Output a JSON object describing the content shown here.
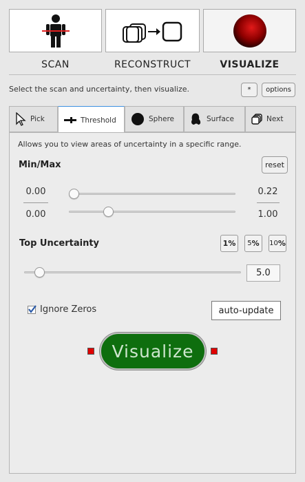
{
  "modes": [
    {
      "label": "SCAN",
      "icon": "person-scan-icon",
      "active": false
    },
    {
      "label": "RECONSTRUCT",
      "icon": "reconstruct-icon",
      "active": false
    },
    {
      "label": "VISUALIZE",
      "icon": "visualize-sphere-icon",
      "active": true
    }
  ],
  "hint": "Select the scan and uncertainty, then visualize.",
  "star_button": "*",
  "options_button": "options",
  "tabs": [
    {
      "label": "Pick",
      "icon": "cursor-icon"
    },
    {
      "label": "Threshold",
      "icon": "threshold-icon"
    },
    {
      "label": "Sphere",
      "icon": "sphere-icon"
    },
    {
      "label": "Surface",
      "icon": "surface-icon"
    },
    {
      "label": "Next",
      "icon": "next-icon"
    }
  ],
  "active_tab": "Threshold",
  "description": "Allows you to view areas of uncertainty in a specific range.",
  "minmax": {
    "title": "Min/Max",
    "reset": "reset",
    "row1": {
      "left": "0.00",
      "right": "0.22",
      "value": 0.0
    },
    "row2": {
      "left": "0.00",
      "right": "1.00",
      "value": 0.22
    }
  },
  "top_uncertainty": {
    "title": "Top Uncertainty",
    "pct_buttons": [
      {
        "num": "1",
        "sym": "%"
      },
      {
        "num": "5",
        "sym": "%"
      },
      {
        "num": "10",
        "sym": "%"
      }
    ],
    "value": "5.0"
  },
  "ignore_zeros": {
    "label": "Ignore Zeros",
    "checked": true
  },
  "auto_update": "auto-update",
  "visualize_button": "Visualize",
  "colors": {
    "visualize_green": "#0e6e0e",
    "led_red": "#e00000",
    "active_tab_accent": "#3b8fe0"
  }
}
